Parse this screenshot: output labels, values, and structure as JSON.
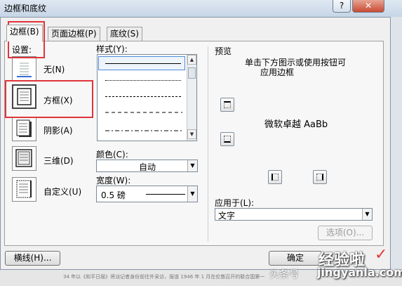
{
  "window": {
    "title": "边框和底纹",
    "help_label": "?",
    "close_label": "✕"
  },
  "tabs": [
    {
      "label": "边框(B)",
      "active": true
    },
    {
      "label": "页面边框(P)",
      "active": false
    },
    {
      "label": "底纹(S)",
      "active": false
    }
  ],
  "settings": {
    "header": "设置:",
    "items": [
      {
        "label": "无(N)",
        "icon": "none-border-icon",
        "selected": false
      },
      {
        "label": "方框(X)",
        "icon": "box-border-icon",
        "selected": true
      },
      {
        "label": "阴影(A)",
        "icon": "shadow-border-icon",
        "selected": false
      },
      {
        "label": "三维(D)",
        "icon": "3d-border-icon",
        "selected": false
      },
      {
        "label": "自定义(U)",
        "icon": "custom-border-icon",
        "selected": false
      }
    ]
  },
  "style": {
    "header": "样式(Y):",
    "lines": [
      {
        "style": "solid",
        "selected": true
      },
      {
        "style": "dotted",
        "selected": false
      },
      {
        "style": "dashed-small",
        "selected": false
      },
      {
        "style": "dashed",
        "selected": false
      },
      {
        "style": "dash-dot",
        "selected": false
      },
      {
        "style": "dash-dot-dot",
        "selected": false
      }
    ]
  },
  "color": {
    "label": "颜色(C):",
    "value": "自动"
  },
  "width": {
    "label": "宽度(W):",
    "value": "0.5 磅"
  },
  "preview": {
    "header": "预览",
    "instruction_line1": "单击下方图示或使用按钮可",
    "instruction_line2": "应用边框",
    "sample_text": "微软卓越 AaBb"
  },
  "apply_to": {
    "label": "应用于(L):",
    "value": "文字"
  },
  "buttons": {
    "options": "选项(O)...",
    "horizontal_line": "横线(H)...",
    "ok": "确定"
  },
  "watermark": {
    "brand": "经验啦",
    "url": "jingyanla.com",
    "source": "头条号",
    "checkmark": "✓"
  },
  "background": {
    "caption": "34 年以《和平日报》将派记者身份前往外采访，报道 1946 年 1 月在伦敦召开的联合国第一"
  },
  "colors": {
    "highlight": "#e0353a",
    "title_bar": "#c6d5e6",
    "dialog_bg": "#f0f0f0"
  }
}
